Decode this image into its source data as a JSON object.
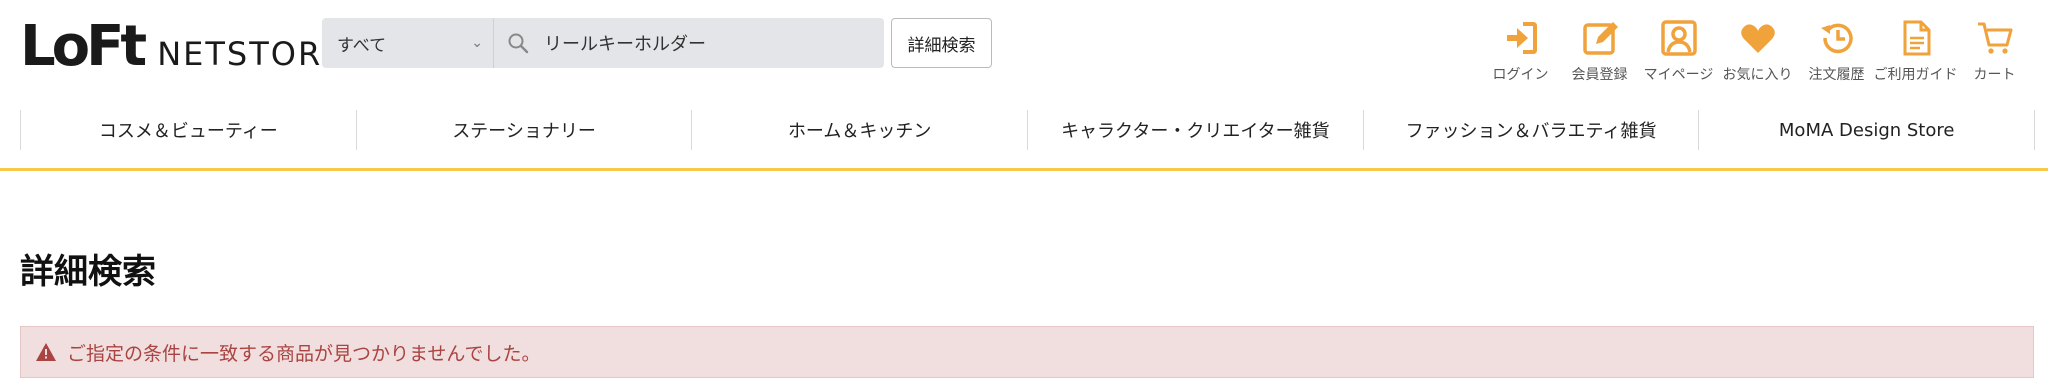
{
  "logo": {
    "mark": "LoFt",
    "word": "NETSTORE"
  },
  "search": {
    "category": "すべて",
    "value": "リールキーホルダー",
    "advanced_label": "詳細検索"
  },
  "header_icons": [
    {
      "label": "ログイン",
      "icon": "login-icon"
    },
    {
      "label": "会員登録",
      "icon": "register-icon"
    },
    {
      "label": "マイページ",
      "icon": "mypage-icon"
    },
    {
      "label": "お気に入り",
      "icon": "heart-icon"
    },
    {
      "label": "注文履歴",
      "icon": "history-icon"
    },
    {
      "label": "ご利用ガイド",
      "icon": "guide-icon"
    },
    {
      "label": "カート",
      "icon": "cart-icon"
    }
  ],
  "nav": [
    "コスメ＆ビューティー",
    "ステーショナリー",
    "ホーム＆キッチン",
    "キャラクター・クリエイター雑貨",
    "ファッション＆バラエティ雑貨",
    "MoMA Design Store"
  ],
  "page": {
    "title": "詳細検索",
    "alert": "ご指定の条件に一致する商品が見つかりませんでした。"
  },
  "colors": {
    "accent": "#f0a23b",
    "nav_underline": "#f7c948",
    "alert_bg": "#f1dede",
    "alert_text": "#a94442"
  }
}
